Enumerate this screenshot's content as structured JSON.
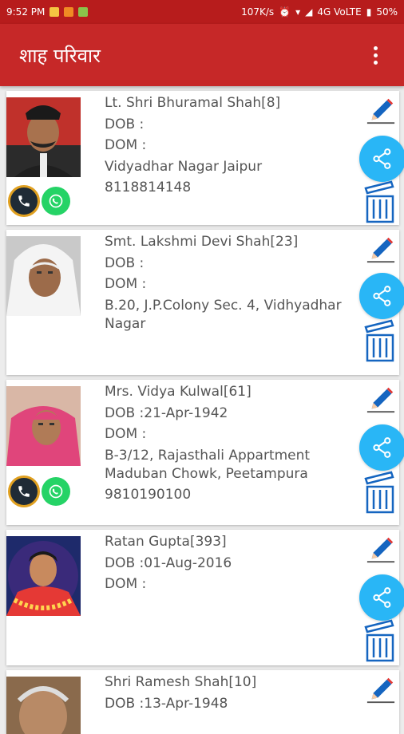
{
  "status": {
    "time": "9:52 PM",
    "speed": "107K/s",
    "network": "4G VoLTE",
    "battery": "50%"
  },
  "appbar": {
    "title": "शाह परिवार"
  },
  "contacts": [
    {
      "name": "Lt. Shri Bhuramal Shah[8]",
      "dob": "DOB :",
      "dom": "DOM :",
      "address": "Vidyadhar Nagar Jaipur",
      "phone": "8118814148"
    },
    {
      "name": "Smt. Lakshmi Devi Shah[23]",
      "dob": "DOB :",
      "dom": "DOM :",
      "address": "B.20, J.P.Colony Sec. 4, Vidhyadhar Nagar",
      "phone": ""
    },
    {
      "name": "Mrs. Vidya Kulwal[61]",
      "dob": "DOB :21-Apr-1942",
      "dom": "DOM :",
      "address": "B-3/12, Rajasthali Appartment Maduban Chowk, Peetampura",
      "phone": "9810190100"
    },
    {
      "name": " Ratan Gupta[393]",
      "dob": "DOB :01-Aug-2016",
      "dom": "DOM :",
      "address": "",
      "phone": ""
    },
    {
      "name": "Shri Ramesh Shah[10]",
      "dob": "DOB :13-Apr-1948",
      "dom": "",
      "address": "",
      "phone": ""
    }
  ],
  "colors": {
    "appbar": "#c62828",
    "statusbar": "#b71c1c",
    "share": "#29b6f6",
    "edit_pencil": "#1565c0",
    "whatsapp": "#25d366"
  }
}
